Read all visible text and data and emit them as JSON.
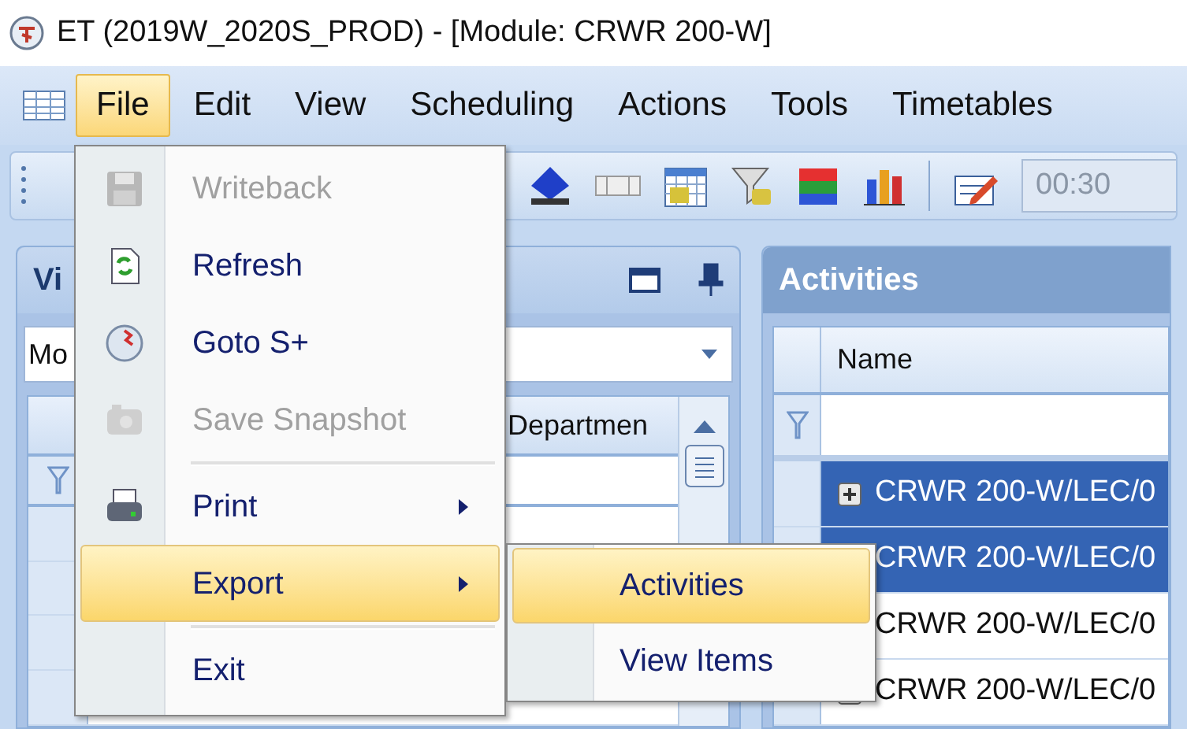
{
  "window": {
    "title": "ET (2019W_2020S_PROD) - [Module: CRWR 200-W]"
  },
  "menu_bar": [
    {
      "label": "File",
      "selected": true
    },
    {
      "label": "Edit",
      "selected": false
    },
    {
      "label": "View",
      "selected": false
    },
    {
      "label": "Scheduling",
      "selected": false
    },
    {
      "label": "Actions",
      "selected": false
    },
    {
      "label": "Tools",
      "selected": false
    },
    {
      "label": "Timetables",
      "selected": false
    }
  ],
  "toolbar": {
    "time_field": "00:30"
  },
  "views_panel": {
    "title": "Vi",
    "combo_value": "Mo",
    "column": "Departmen"
  },
  "activities_panel": {
    "title": "Activities",
    "column": "Name",
    "rows": [
      {
        "name": "CRWR 200-W/LEC/0",
        "expandable": true,
        "selected": true
      },
      {
        "name": "CRWR 200-W/LEC/0",
        "selected": true
      },
      {
        "name": "CRWR 200-W/LEC/0",
        "selected": false
      },
      {
        "name": "CRWR 200-W/LEC/0",
        "expandable": true,
        "selected": false
      }
    ]
  },
  "file_menu": [
    {
      "label": "Writeback",
      "disabled": true,
      "has_submenu": false,
      "selected": false,
      "separator_before": false
    },
    {
      "label": "Refresh",
      "disabled": false,
      "has_submenu": false,
      "selected": false,
      "separator_before": false
    },
    {
      "label": "Goto S+",
      "disabled": false,
      "has_submenu": false,
      "selected": false,
      "separator_before": false
    },
    {
      "label": "Save Snapshot",
      "disabled": true,
      "has_submenu": false,
      "selected": false,
      "separator_before": false
    },
    {
      "label": "Print",
      "disabled": false,
      "has_submenu": true,
      "selected": false,
      "separator_before": true
    },
    {
      "label": "Export",
      "disabled": false,
      "has_submenu": true,
      "selected": true,
      "separator_before": false
    },
    {
      "label": "Exit",
      "disabled": false,
      "has_submenu": false,
      "selected": false,
      "separator_before": true
    }
  ],
  "export_submenu": [
    {
      "label": "Activities",
      "selected": true
    },
    {
      "label": "View Items",
      "selected": false
    }
  ]
}
